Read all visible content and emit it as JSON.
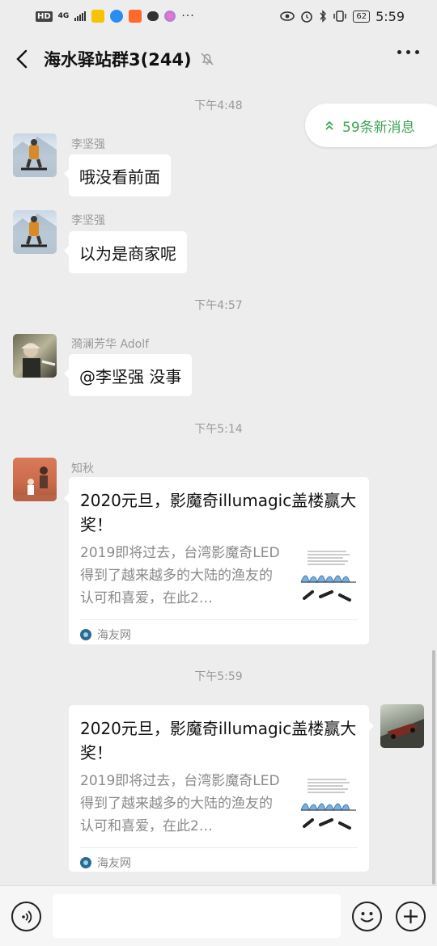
{
  "status_bar": {
    "hd": "HD",
    "network": "4G",
    "battery": "62",
    "time": "5:59"
  },
  "header": {
    "title": "海水驿站群3(244)"
  },
  "new_messages": "59条新消息",
  "messages": [
    {
      "timestamp": "下午4:48"
    },
    {
      "sender": "李坚强",
      "text": "哦没看前面"
    },
    {
      "sender": "李坚强",
      "text": "以为是商家呢"
    },
    {
      "timestamp": "下午4:57"
    },
    {
      "sender": "漪澜芳华 Adolf",
      "text": "@李坚强  没事"
    },
    {
      "timestamp": "下午5:14"
    },
    {
      "sender": "知秋",
      "card": {
        "title": "2020元旦，影魔奇illumagic盖楼赢大奖！",
        "desc": "2019即将过去，台湾影魔奇LED得到了越来越多的大陆的渔友的认可和喜爱，在此2…",
        "source": "海友网"
      }
    },
    {
      "timestamp": "下午5:59"
    },
    {
      "self": true,
      "card": {
        "title": "2020元旦，影魔奇illumagic盖楼赢大奖！",
        "desc": "2019即将过去，台湾影魔奇LED得到了越来越多的大陆的渔友的认可和喜爱，在此2…",
        "source": "海友网"
      }
    }
  ],
  "icons": {
    "back": "chevron-left-icon",
    "mute": "bell-off-icon",
    "more": "more-dots-icon",
    "voice": "voice-icon",
    "emoji": "emoji-icon",
    "plus": "plus-icon"
  },
  "colors": {
    "background": "#ededed",
    "accent_green": "#3ea555",
    "timestamp_gray": "#9a9a9a"
  }
}
